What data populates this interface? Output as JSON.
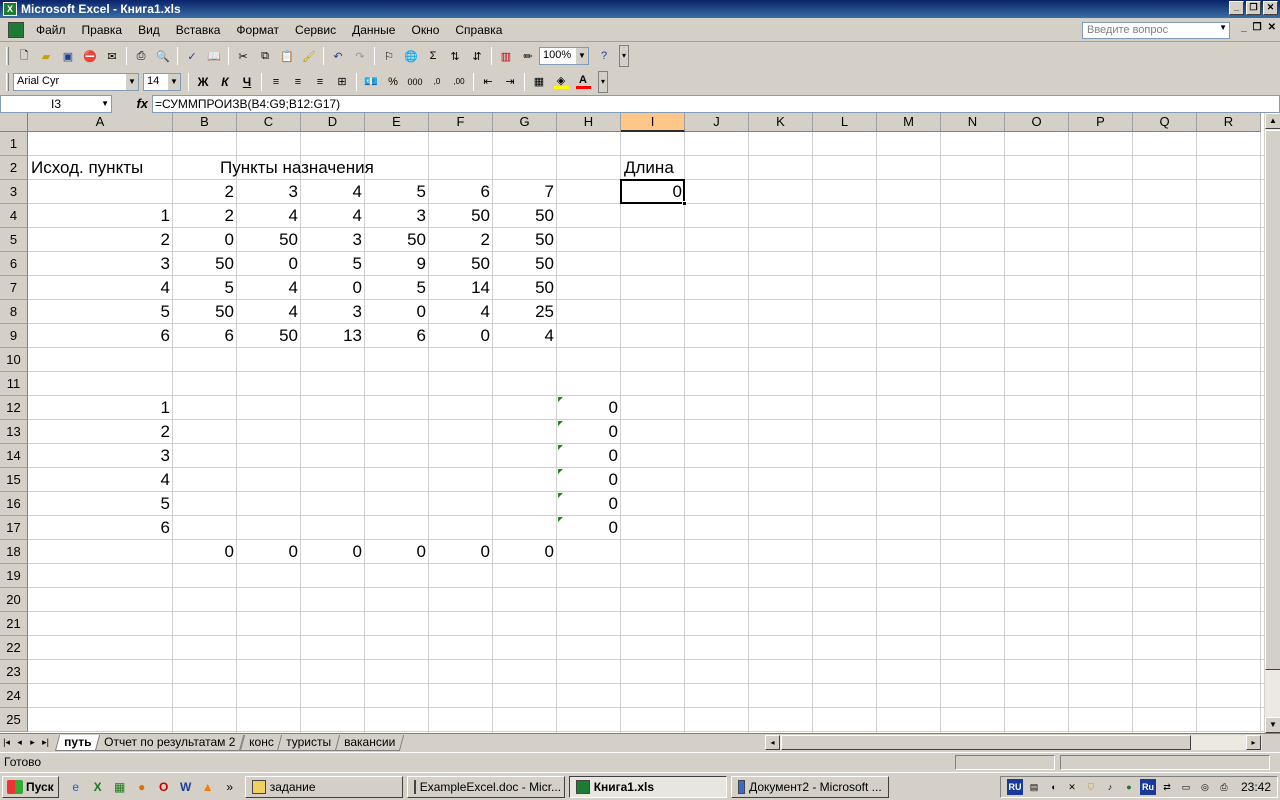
{
  "window": {
    "title": "Microsoft Excel - Книга1.xls"
  },
  "menu": {
    "items": [
      {
        "label": "Файл"
      },
      {
        "label": "Правка"
      },
      {
        "label": "Вид"
      },
      {
        "label": "Вставка"
      },
      {
        "label": "Формат"
      },
      {
        "label": "Сервис"
      },
      {
        "label": "Данные"
      },
      {
        "label": "Окно"
      },
      {
        "label": "Справка"
      }
    ],
    "help_placeholder": "Введите вопрос"
  },
  "toolbar": {
    "zoom": "100%"
  },
  "format_toolbar": {
    "font": "Arial Cyr",
    "size": "14",
    "bold": "Ж",
    "italic": "К",
    "underline": "Ч"
  },
  "formula_bar": {
    "name_box": "I3",
    "fx": "fx",
    "formula": "=СУММПРОИЗВ(B4:G9;B12:G17)"
  },
  "columns": [
    "A",
    "B",
    "C",
    "D",
    "E",
    "F",
    "G",
    "H",
    "I",
    "J",
    "K",
    "L",
    "M",
    "N",
    "O",
    "P",
    "Q",
    "R"
  ],
  "rows": [
    "1",
    "2",
    "3",
    "4",
    "5",
    "6",
    "7",
    "8",
    "9",
    "10",
    "11",
    "12",
    "13",
    "14",
    "15",
    "16",
    "17",
    "18",
    "19",
    "20",
    "21",
    "22",
    "23",
    "24",
    "25"
  ],
  "sheet": {
    "A2": "Исход. пункты",
    "C2": "Пункты назначения",
    "I2": "Длина",
    "header_row": [
      "2",
      "3",
      "4",
      "5",
      "6",
      "7"
    ],
    "matrix": [
      {
        "label": "1",
        "values": [
          "2",
          "4",
          "4",
          "3",
          "50",
          "50"
        ]
      },
      {
        "label": "2",
        "values": [
          "0",
          "50",
          "3",
          "50",
          "2",
          "50"
        ]
      },
      {
        "label": "3",
        "values": [
          "50",
          "0",
          "5",
          "9",
          "50",
          "50"
        ]
      },
      {
        "label": "4",
        "values": [
          "5",
          "4",
          "0",
          "5",
          "14",
          "50"
        ]
      },
      {
        "label": "5",
        "values": [
          "50",
          "4",
          "3",
          "0",
          "4",
          "25"
        ]
      },
      {
        "label": "6",
        "values": [
          "6",
          "50",
          "13",
          "6",
          "0",
          "4"
        ]
      }
    ],
    "I3": "0",
    "lower_labels": [
      "1",
      "2",
      "3",
      "4",
      "5",
      "6"
    ],
    "lower_h_values": [
      "0",
      "0",
      "0",
      "0",
      "0",
      "0"
    ],
    "row18": [
      "0",
      "0",
      "0",
      "0",
      "0",
      "0"
    ]
  },
  "tabs": [
    {
      "label": "путь",
      "active": true
    },
    {
      "label": "Отчет по результатам 2"
    },
    {
      "label": "конс"
    },
    {
      "label": "туристы"
    },
    {
      "label": "вакансии"
    }
  ],
  "status": {
    "text": "Готово"
  },
  "taskbar": {
    "start": "Пуск",
    "tasks": [
      {
        "label": "задание"
      },
      {
        "label": "ExampleExcel.doc - Micr..."
      },
      {
        "label": "Книга1.xls",
        "active": true
      },
      {
        "label": "Документ2 - Microsoft ..."
      }
    ],
    "tray_lang": "RU",
    "tray_lang2": "Ru",
    "clock": "23:42"
  },
  "colors": {
    "selected_header": "#ffc68a",
    "title_bar": "#0a246a",
    "error_triangle": "#1e8a1e"
  }
}
